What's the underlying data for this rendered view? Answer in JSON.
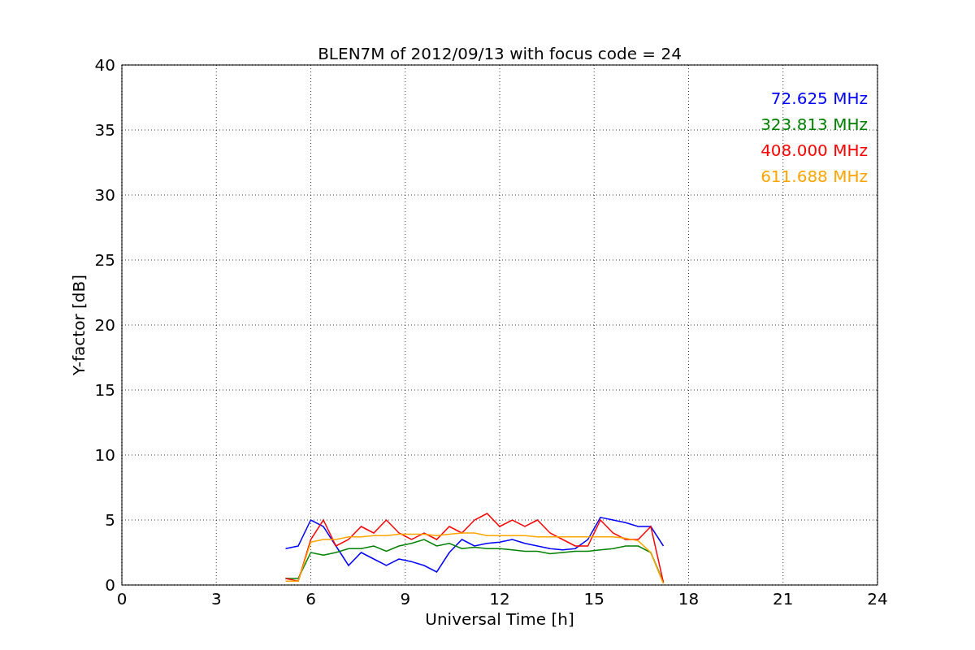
{
  "chart_data": {
    "type": "line",
    "title": "BLEN7M of 2012/09/13 with focus code = 24",
    "xlabel": "Universal Time [h]",
    "ylabel": "Y-factor [dB]",
    "x": [
      5.2,
      5.6,
      6.0,
      6.4,
      6.8,
      7.2,
      7.6,
      8.0,
      8.4,
      8.8,
      9.2,
      9.6,
      10.0,
      10.4,
      10.8,
      11.2,
      11.6,
      12.0,
      12.4,
      12.8,
      13.2,
      13.6,
      14.0,
      14.4,
      14.8,
      15.2,
      15.6,
      16.0,
      16.4,
      16.8,
      17.2
    ],
    "series": [
      {
        "name": "72.625 MHz",
        "color": "#0000ff",
        "values": [
          2.8,
          3.0,
          5.0,
          4.5,
          3.0,
          1.5,
          2.5,
          2.0,
          1.5,
          2.0,
          1.8,
          1.5,
          1.0,
          2.5,
          3.5,
          3.0,
          3.2,
          3.3,
          3.5,
          3.2,
          3.0,
          2.8,
          2.7,
          2.8,
          3.5,
          5.2,
          5.0,
          4.8,
          4.5,
          4.5,
          3.0
        ]
      },
      {
        "name": "323.813 MHz",
        "color": "#008000",
        "values": [
          0.5,
          0.5,
          2.5,
          2.3,
          2.5,
          2.8,
          2.8,
          3.0,
          2.6,
          3.0,
          3.2,
          3.5,
          3.0,
          3.2,
          2.8,
          2.9,
          2.8,
          2.8,
          2.7,
          2.6,
          2.6,
          2.4,
          2.5,
          2.6,
          2.6,
          2.7,
          2.8,
          3.0,
          3.0,
          2.5,
          0.2
        ]
      },
      {
        "name": "408.000 MHz",
        "color": "#ff0000",
        "values": [
          0.5,
          0.3,
          3.5,
          5.0,
          3.0,
          3.5,
          4.5,
          4.0,
          5.0,
          4.0,
          3.5,
          4.0,
          3.5,
          4.5,
          4.0,
          5.0,
          5.5,
          4.5,
          5.0,
          4.5,
          5.0,
          4.0,
          3.5,
          3.0,
          3.0,
          5.0,
          4.0,
          3.5,
          3.5,
          4.5,
          0.2
        ]
      },
      {
        "name": "611.688 MHz",
        "color": "#ffa500",
        "values": [
          0.3,
          0.3,
          3.3,
          3.5,
          3.5,
          3.7,
          3.7,
          3.8,
          3.8,
          3.9,
          3.9,
          3.9,
          3.8,
          3.9,
          4.0,
          4.0,
          3.8,
          3.8,
          3.8,
          3.8,
          3.7,
          3.7,
          3.7,
          3.7,
          3.7,
          3.7,
          3.7,
          3.6,
          3.4,
          2.5,
          0.1
        ]
      }
    ],
    "xlim": [
      0,
      24
    ],
    "ylim": [
      0,
      40
    ],
    "xticks": [
      0,
      3,
      6,
      9,
      12,
      15,
      18,
      21,
      24
    ],
    "yticks": [
      0,
      5,
      10,
      15,
      20,
      25,
      30,
      35,
      40
    ],
    "grid": true
  }
}
